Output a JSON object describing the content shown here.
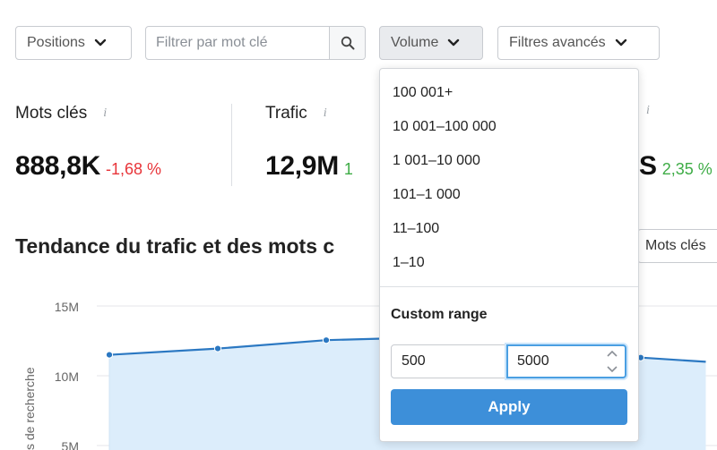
{
  "filters": {
    "positions_label": "Positions",
    "search_placeholder": "Filtrer par mot clé",
    "volume_label": "Volume",
    "advanced_label": "Filtres avancés"
  },
  "metrics": [
    {
      "label": "Mots clés",
      "value": "888,8K",
      "change": "-1,68 %",
      "direction": "down"
    },
    {
      "label": "Trafic",
      "value": "12,9M",
      "change": "1",
      "direction": "up"
    },
    {
      "label": "",
      "value": "S",
      "change": "2,35 %",
      "direction": "up"
    }
  ],
  "section": {
    "title": "Tendance du trafic et des mots c",
    "series_selector": "Mots clés"
  },
  "volume_dropdown": {
    "options": [
      "100 001+",
      "10 001–100 000",
      "1 001–10 000",
      "101–1 000",
      "11–100",
      "1–10"
    ],
    "custom_range_label": "Custom range",
    "min_value": "500",
    "max_value": "5000",
    "apply_label": "Apply"
  },
  "colors": {
    "line": "#2b78c2",
    "area": "#dcedfb",
    "negative": "#e8353a",
    "positive": "#3eac46",
    "apply": "#3d8fd9"
  },
  "chart_data": {
    "type": "area",
    "ylabel": "s de recherche",
    "y_ticks": [
      "15M",
      "10M",
      "5M"
    ],
    "ylim": [
      5000000,
      15000000
    ],
    "points": [
      {
        "x": 0,
        "y": 11500000
      },
      {
        "x": 1,
        "y": 11950000
      },
      {
        "x": 2,
        "y": 12550000
      },
      {
        "x": 2.7,
        "y": 12700000
      },
      {
        "x": 4.9,
        "y": 11300000
      },
      {
        "x": 5.5,
        "y": 11000000
      }
    ],
    "series": [
      {
        "name": "",
        "color": "#2b78c2"
      }
    ]
  }
}
